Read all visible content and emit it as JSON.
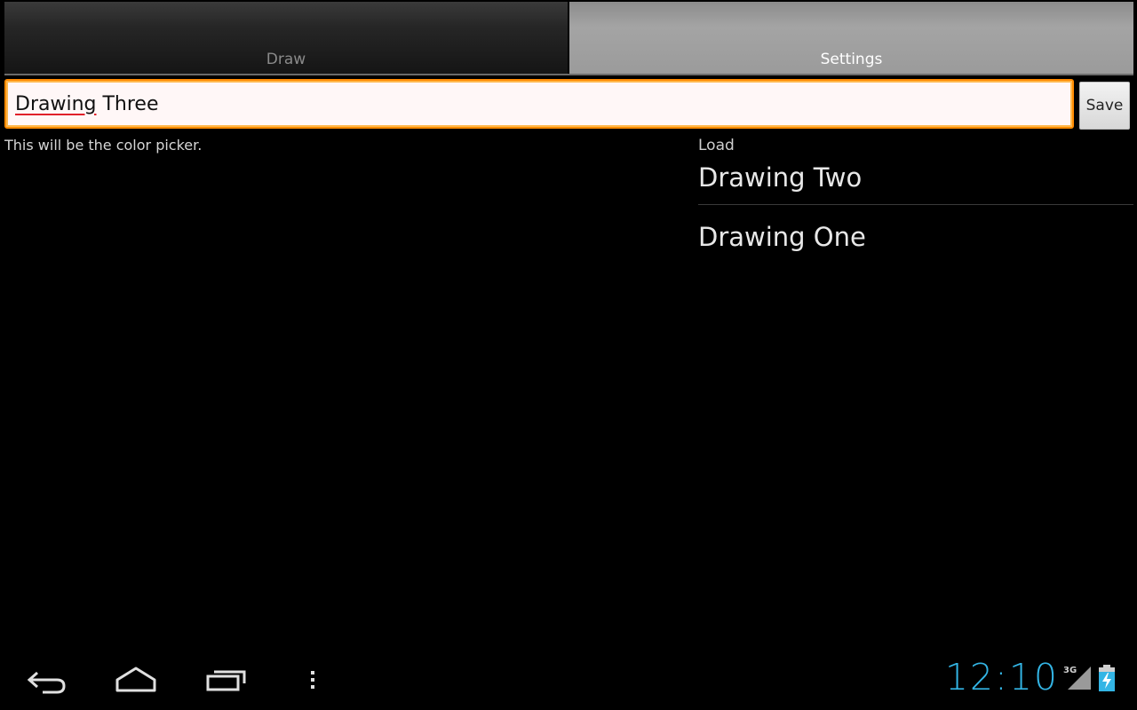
{
  "tabs": [
    {
      "label": "Draw",
      "selected": false
    },
    {
      "label": "Settings",
      "selected": true
    }
  ],
  "name_field": {
    "value_word1": "Drawing",
    "value_rest": " Three"
  },
  "save_button": {
    "label": "Save"
  },
  "color_picker": {
    "text": "This will be the color picker."
  },
  "load": {
    "label": "Load",
    "items": [
      "Drawing Two",
      "Drawing One"
    ]
  },
  "status_bar": {
    "time": "12:10",
    "network": "3G",
    "icons": [
      "back-icon",
      "home-icon",
      "recent-apps-icon",
      "menu-icon",
      "signal-icon",
      "battery-charging-icon"
    ]
  },
  "colors": {
    "accent": "#ff8a00",
    "clock": "#33b5e5",
    "selected_tab": "#9b9b9b"
  }
}
